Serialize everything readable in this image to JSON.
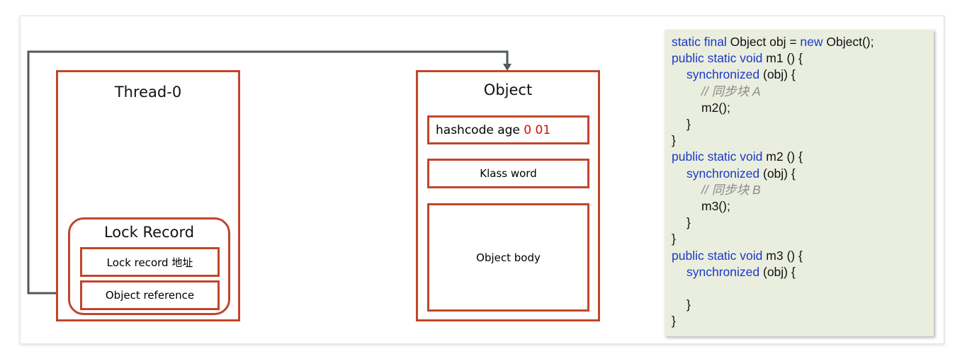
{
  "thread": {
    "title": "Thread-0",
    "lock_record": {
      "title": "Lock Record",
      "field_address": "Lock record 地址",
      "field_reference": "Object reference"
    }
  },
  "object": {
    "title": "Object",
    "mark_word_text": "hashcode age ",
    "mark_word_bits": "0 01",
    "klass_word": "Klass word",
    "body": "Object body"
  },
  "colors": {
    "box_border": "#c0462c",
    "connector": "#505a5a",
    "keyword": "#1b39c8",
    "bits": "#d01010",
    "code_bg": "#eaeedf"
  },
  "code": {
    "lines": [
      {
        "indent": 0,
        "parts": [
          {
            "t": "static final",
            "c": "kw"
          },
          {
            "t": " Object obj = ",
            "c": ""
          },
          {
            "t": "new",
            "c": "kw"
          },
          {
            "t": " Object();",
            "c": ""
          }
        ]
      },
      {
        "indent": 0,
        "parts": [
          {
            "t": "public static void",
            "c": "kw"
          },
          {
            "t": " m1 () {",
            "c": ""
          }
        ]
      },
      {
        "indent": 1,
        "parts": [
          {
            "t": "synchronized",
            "c": "kw"
          },
          {
            "t": " (obj) {",
            "c": ""
          }
        ]
      },
      {
        "indent": 2,
        "parts": [
          {
            "t": "// 同步块 A",
            "c": "cm"
          }
        ]
      },
      {
        "indent": 2,
        "parts": [
          {
            "t": "m2();",
            "c": ""
          }
        ]
      },
      {
        "indent": 1,
        "parts": [
          {
            "t": "}",
            "c": ""
          }
        ]
      },
      {
        "indent": 0,
        "parts": [
          {
            "t": "}",
            "c": ""
          }
        ]
      },
      {
        "indent": 0,
        "parts": [
          {
            "t": "public static void",
            "c": "kw"
          },
          {
            "t": " m2 () {",
            "c": ""
          }
        ]
      },
      {
        "indent": 1,
        "parts": [
          {
            "t": "synchronized",
            "c": "kw"
          },
          {
            "t": " (obj) {",
            "c": ""
          }
        ]
      },
      {
        "indent": 2,
        "parts": [
          {
            "t": "// 同步块 B",
            "c": "cm"
          }
        ]
      },
      {
        "indent": 2,
        "parts": [
          {
            "t": "m3();",
            "c": ""
          }
        ]
      },
      {
        "indent": 1,
        "parts": [
          {
            "t": "}",
            "c": ""
          }
        ]
      },
      {
        "indent": 0,
        "parts": [
          {
            "t": "}",
            "c": ""
          }
        ]
      },
      {
        "indent": 0,
        "parts": [
          {
            "t": "public static void",
            "c": "kw"
          },
          {
            "t": " m3 () {",
            "c": ""
          }
        ]
      },
      {
        "indent": 1,
        "parts": [
          {
            "t": "synchronized",
            "c": "kw"
          },
          {
            "t": " (obj) {",
            "c": ""
          }
        ]
      },
      {
        "indent": 0,
        "parts": []
      },
      {
        "indent": 1,
        "parts": [
          {
            "t": "}",
            "c": ""
          }
        ]
      },
      {
        "indent": 0,
        "parts": [
          {
            "t": "}",
            "c": ""
          }
        ]
      }
    ]
  }
}
